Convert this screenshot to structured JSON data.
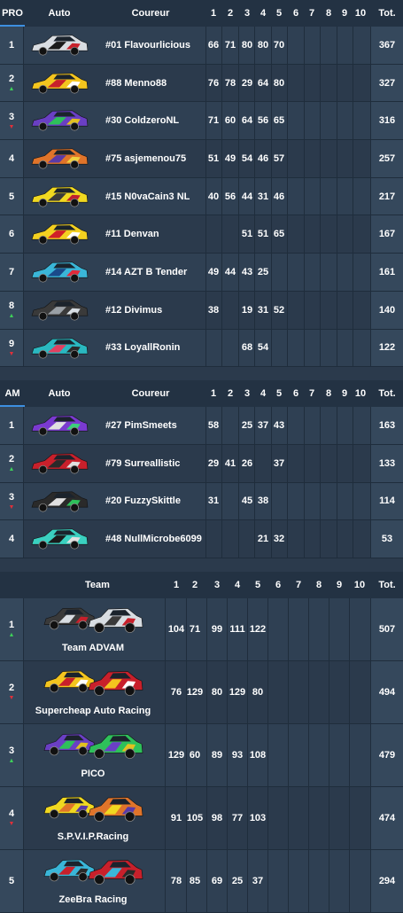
{
  "pro": {
    "header": {
      "tab": "PRO",
      "car": "Auto",
      "driver": "Coureur",
      "rounds": [
        "1",
        "2",
        "3",
        "4",
        "5",
        "6",
        "7",
        "8",
        "9",
        "10"
      ],
      "total": "Tot."
    },
    "rows": [
      {
        "pos": "1",
        "arrow": "",
        "driver": "#01 Flavourlicious",
        "scores": [
          "66",
          "71",
          "80",
          "80",
          "70",
          "",
          "",
          "",
          "",
          ""
        ],
        "total": "367",
        "car_colors": [
          "#d9dde2",
          "#1a1a1a",
          "#c8202b"
        ]
      },
      {
        "pos": "2",
        "arrow": "up",
        "driver": "#88 Menno88",
        "scores": [
          "76",
          "78",
          "29",
          "64",
          "80",
          "",
          "",
          "",
          "",
          ""
        ],
        "total": "327",
        "car_colors": [
          "#f4c51e",
          "#c8202b",
          "#ffffff"
        ]
      },
      {
        "pos": "3",
        "arrow": "down",
        "driver": "#30 ColdzeroNL",
        "scores": [
          "71",
          "60",
          "64",
          "56",
          "65",
          "",
          "",
          "",
          "",
          ""
        ],
        "total": "316",
        "car_colors": [
          "#6a3fc4",
          "#2ec05a",
          "#e2c020"
        ]
      },
      {
        "pos": "4",
        "arrow": "",
        "driver": "#75 asjemenou75",
        "scores": [
          "51",
          "49",
          "54",
          "46",
          "57",
          "",
          "",
          "",
          "",
          ""
        ],
        "total": "257",
        "car_colors": [
          "#e0742a",
          "#5a3aa8",
          "#f0d040"
        ]
      },
      {
        "pos": "5",
        "arrow": "",
        "driver": "#15 N0vaCain3 NL",
        "scores": [
          "40",
          "56",
          "44",
          "31",
          "46",
          "",
          "",
          "",
          "",
          ""
        ],
        "total": "217",
        "car_colors": [
          "#f0d820",
          "#3a3a3a",
          "#c02030"
        ]
      },
      {
        "pos": "6",
        "arrow": "",
        "driver": "#11 Denvan",
        "scores": [
          "",
          "",
          "51",
          "51",
          "65",
          "",
          "",
          "",
          "",
          ""
        ],
        "total": "167",
        "car_colors": [
          "#f3d020",
          "#d02028",
          "#ffffff"
        ]
      },
      {
        "pos": "7",
        "arrow": "",
        "driver": "#14 AZT B Tender",
        "scores": [
          "49",
          "44",
          "43",
          "25",
          "",
          "",
          "",
          "",
          "",
          ""
        ],
        "total": "161",
        "car_colors": [
          "#3ab6d8",
          "#1a4a8a",
          "#e02a3a"
        ]
      },
      {
        "pos": "8",
        "arrow": "up",
        "driver": "#12 Divimus",
        "scores": [
          "38",
          "",
          "19",
          "31",
          "52",
          "",
          "",
          "",
          "",
          ""
        ],
        "total": "140",
        "car_colors": [
          "#3a3a3a",
          "#9aa0a6",
          "#d8dde2"
        ]
      },
      {
        "pos": "9",
        "arrow": "down",
        "driver": "#33 LoyallRonin",
        "scores": [
          "",
          "",
          "68",
          "54",
          "",
          "",
          "",
          "",
          "",
          ""
        ],
        "total": "122",
        "car_colors": [
          "#2ab8c0",
          "#e04060",
          "#2a2a2a"
        ]
      }
    ]
  },
  "am": {
    "header": {
      "tab": "AM",
      "car": "Auto",
      "driver": "Coureur",
      "rounds": [
        "1",
        "2",
        "3",
        "4",
        "5",
        "6",
        "7",
        "8",
        "9",
        "10"
      ],
      "total": "Tot."
    },
    "rows": [
      {
        "pos": "1",
        "arrow": "",
        "driver": "#27 PimSmeets",
        "scores": [
          "58",
          "",
          "25",
          "37",
          "43",
          "",
          "",
          "",
          "",
          ""
        ],
        "total": "163",
        "car_colors": [
          "#7a3ad0",
          "#e0e0e0",
          "#3ad07a"
        ]
      },
      {
        "pos": "2",
        "arrow": "up",
        "driver": "#79 Surreallistic",
        "scores": [
          "29",
          "41",
          "26",
          "",
          "37",
          "",
          "",
          "",
          "",
          ""
        ],
        "total": "133",
        "car_colors": [
          "#c8202b",
          "#2a2a2a",
          "#e0e0e0"
        ]
      },
      {
        "pos": "3",
        "arrow": "down",
        "driver": "#20 FuzzySkittle",
        "scores": [
          "31",
          "",
          "45",
          "38",
          "",
          "",
          "",
          "",
          "",
          ""
        ],
        "total": "114",
        "car_colors": [
          "#2a2a2a",
          "#e0e0e0",
          "#2ec05a"
        ]
      },
      {
        "pos": "4",
        "arrow": "",
        "driver": "#48 NullMicrobe6099",
        "scores": [
          "",
          "",
          "",
          "21",
          "32",
          "",
          "",
          "",
          "",
          ""
        ],
        "total": "53",
        "car_colors": [
          "#3ad0c0",
          "#1a1a1a",
          "#e0e0e0"
        ]
      }
    ]
  },
  "teams": {
    "header": {
      "team": "Team",
      "rounds": [
        "1",
        "2",
        "3",
        "4",
        "5",
        "6",
        "7",
        "8",
        "9",
        "10"
      ],
      "total": "Tot."
    },
    "rows": [
      {
        "pos": "1",
        "arrow": "up",
        "name": "Team ADVAM",
        "scores": [
          "104",
          "71",
          "99",
          "111",
          "122",
          "",
          "",
          "",
          "",
          ""
        ],
        "total": "507",
        "car_colors": [
          "#3a3a3a",
          "#d8dde2",
          "#c8202b"
        ]
      },
      {
        "pos": "2",
        "arrow": "down",
        "name": "Supercheap Auto Racing",
        "scores": [
          "76",
          "129",
          "80",
          "129",
          "80",
          "",
          "",
          "",
          "",
          ""
        ],
        "total": "494",
        "car_colors": [
          "#f4c51e",
          "#c8202b",
          "#ffffff"
        ]
      },
      {
        "pos": "3",
        "arrow": "up",
        "name": "PICO",
        "scores": [
          "129",
          "60",
          "89",
          "93",
          "108",
          "",
          "",
          "",
          "",
          ""
        ],
        "total": "479",
        "car_colors": [
          "#6a3fc4",
          "#2ec05a",
          "#e2c020"
        ]
      },
      {
        "pos": "4",
        "arrow": "down",
        "name": "S.P.V.I.P.Racing",
        "scores": [
          "91",
          "105",
          "98",
          "77",
          "103",
          "",
          "",
          "",
          "",
          ""
        ],
        "total": "474",
        "car_colors": [
          "#f0d820",
          "#e0742a",
          "#5a3aa8"
        ]
      },
      {
        "pos": "5",
        "arrow": "",
        "name": "ZeeBra Racing",
        "scores": [
          "78",
          "85",
          "69",
          "25",
          "37",
          "",
          "",
          "",
          "",
          ""
        ],
        "total": "294",
        "car_colors": [
          "#3ab6d8",
          "#c8202b",
          "#2a2a2a"
        ]
      }
    ]
  }
}
